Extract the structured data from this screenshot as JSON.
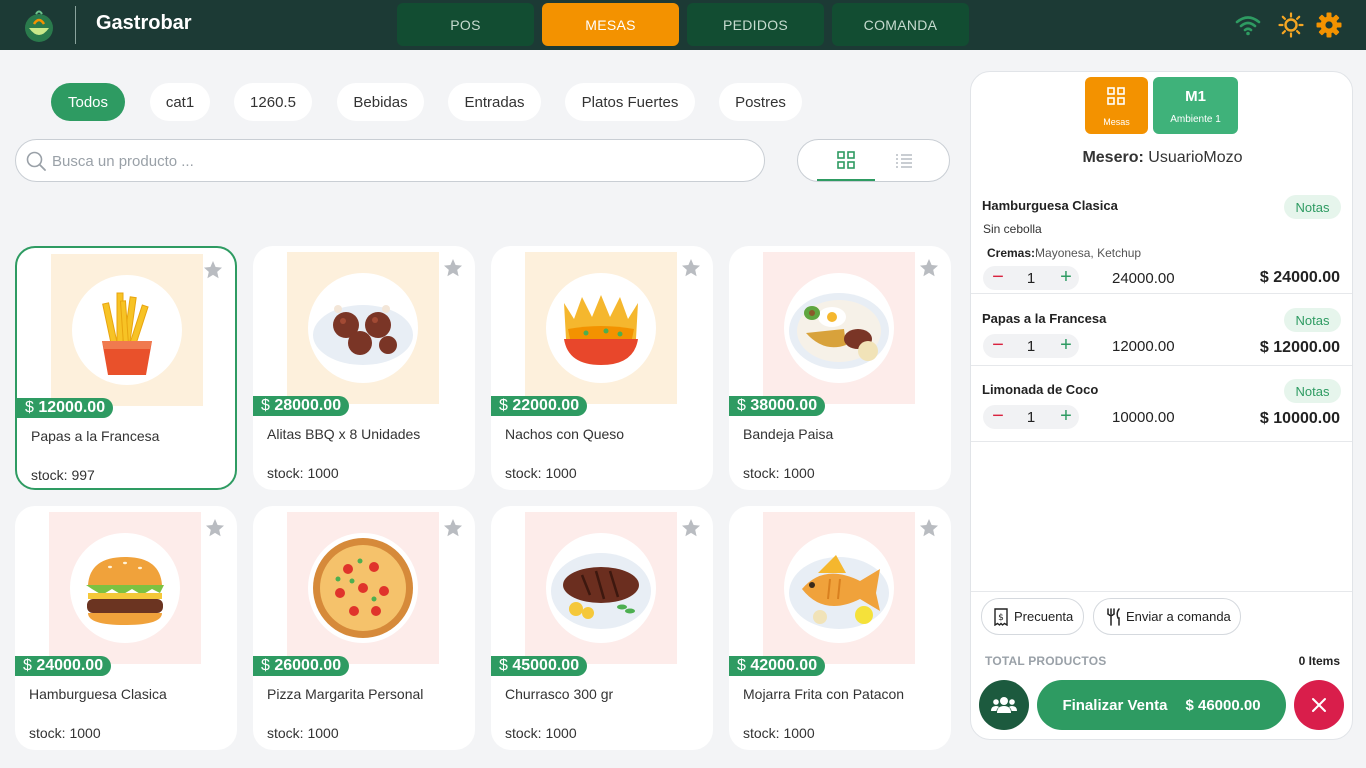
{
  "header": {
    "brand": "Gastrobar",
    "nav": [
      {
        "label": "POS",
        "active": false
      },
      {
        "label": "MESAS",
        "active": true
      },
      {
        "label": "PEDIDOS",
        "active": false
      },
      {
        "label": "COMANDA",
        "active": false
      }
    ],
    "icons": [
      "wifi-icon",
      "sun-icon",
      "gear-icon"
    ]
  },
  "categories": [
    "Todos",
    "cat1",
    "1260.5",
    "Bebidas",
    "Entradas",
    "Platos Fuertes",
    "Postres"
  ],
  "search": {
    "placeholder": "Busca un producto ..."
  },
  "products": [
    {
      "name": "Papas a la Francesa",
      "currency": "$",
      "price": "12000.00",
      "stock": "stock: 997",
      "selected": true,
      "icon": "fries-icon"
    },
    {
      "name": "Alitas BBQ x 8 Unidades",
      "currency": "$",
      "price": "28000.00",
      "stock": "stock: 1000",
      "icon": "wings-icon"
    },
    {
      "name": "Nachos con Queso",
      "currency": "$",
      "price": "22000.00",
      "stock": "stock: 1000",
      "icon": "nachos-icon"
    },
    {
      "name": "Bandeja Paisa",
      "currency": "$",
      "price": "38000.00",
      "stock": "stock: 1000",
      "icon": "bandeja-icon"
    },
    {
      "name": "Hamburguesa Clasica",
      "currency": "$",
      "price": "24000.00",
      "stock": "stock: 1000",
      "icon": "burger-icon"
    },
    {
      "name": "Pizza Margarita Personal",
      "currency": "$",
      "price": "26000.00",
      "stock": "stock: 1000",
      "icon": "pizza-icon"
    },
    {
      "name": "Churrasco 300 gr",
      "currency": "$",
      "price": "45000.00",
      "stock": "stock: 1000",
      "icon": "steak-icon"
    },
    {
      "name": "Mojarra Frita con Patacon",
      "currency": "$",
      "price": "42000.00",
      "stock": "stock: 1000",
      "icon": "fish-icon"
    }
  ],
  "panel": {
    "mesas_label": "Mesas",
    "table_code": "M1",
    "table_env": "Ambiente 1",
    "mesero_label": "Mesero:",
    "mesero_name": "UsuarioMozo",
    "notes_label": "Notas",
    "items": [
      {
        "name": "Hamburguesa Clasica",
        "note": "Sin cebolla",
        "cremas_label": "Cremas:",
        "cremas": "Mayonesa, Ketchup",
        "qty": "1",
        "unit": "24000.00",
        "total": "$ 24000.00"
      },
      {
        "name": "Papas a la Francesa",
        "qty": "1",
        "unit": "12000.00",
        "total": "$ 12000.00"
      },
      {
        "name": "Limonada de Coco",
        "qty": "1",
        "unit": "10000.00",
        "total": "$ 10000.00"
      }
    ],
    "precuenta": "Precuenta",
    "enviar": "Enviar a comanda",
    "total_label": "TOTAL PRODUCTOS",
    "total_items": "0 Items",
    "finalizar": "Finalizar Venta",
    "finalizar_amount": "$ 46000.00"
  },
  "colors": {
    "brand_green": "#2e9b62",
    "accent_orange": "#f39200",
    "header_bg": "#1c3a35",
    "danger": "#d91e4b"
  }
}
